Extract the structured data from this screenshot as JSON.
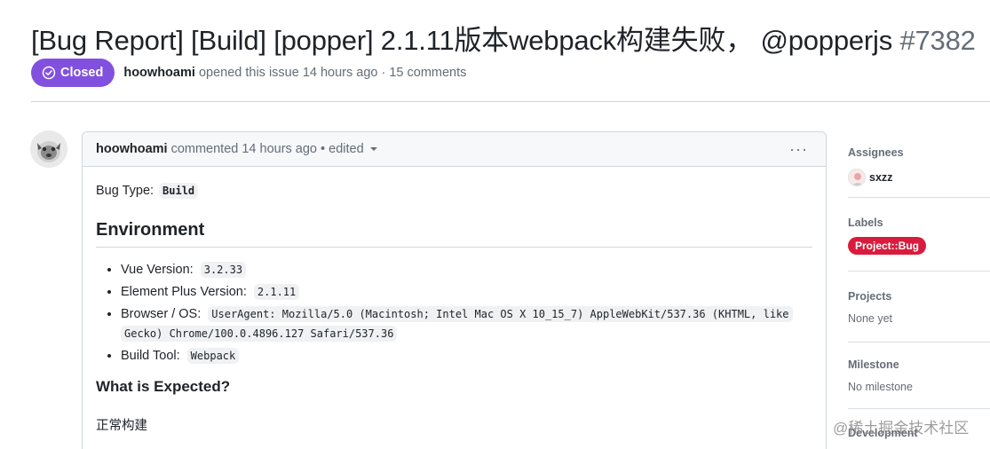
{
  "issue": {
    "title": "[Bug Report] [Build] [popper] 2.1.11版本webpack构建失败， @popperjs",
    "number": "#7382"
  },
  "meta": {
    "state": "Closed",
    "author": "hoowhoami",
    "opened_text": "opened this issue 14 hours ago · 15 comments"
  },
  "comment": {
    "author": "hoowhoami",
    "action": "commented 14 hours ago • edited",
    "menu_glyph": "···",
    "bug_type_label": "Bug Type:",
    "bug_type_value": "Build",
    "env_heading": "Environment",
    "env_items": [
      {
        "label": "Vue Version:",
        "value": "3.2.33"
      },
      {
        "label": "Element Plus Version:",
        "value": "2.1.11"
      },
      {
        "label": "Browser / OS:",
        "value": "UserAgent: Mozilla/5.0 (Macintosh; Intel Mac OS X 10_15_7) AppleWebKit/537.36 (KHTML, like",
        "value_cont": "Gecko) Chrome/100.0.4896.127 Safari/537.36"
      },
      {
        "label": "Build Tool:",
        "value": "Webpack"
      }
    ],
    "expected_heading": "What is Expected?",
    "expected_text": "正常构建"
  },
  "sidebar": {
    "assignees_title": "Assignees",
    "assignee_name": "sxzz",
    "labels_title": "Labels",
    "label_name": "Project::Bug",
    "label_color": "#d91c3d",
    "projects_title": "Projects",
    "projects_value": "None yet",
    "milestone_title": "Milestone",
    "milestone_value": "No milestone",
    "development_title": "Development"
  },
  "watermark": "@稀土掘金技术社区",
  "colors": {
    "closed_badge": "#8250df",
    "muted_text": "#656d76",
    "border": "#d0d7de"
  }
}
